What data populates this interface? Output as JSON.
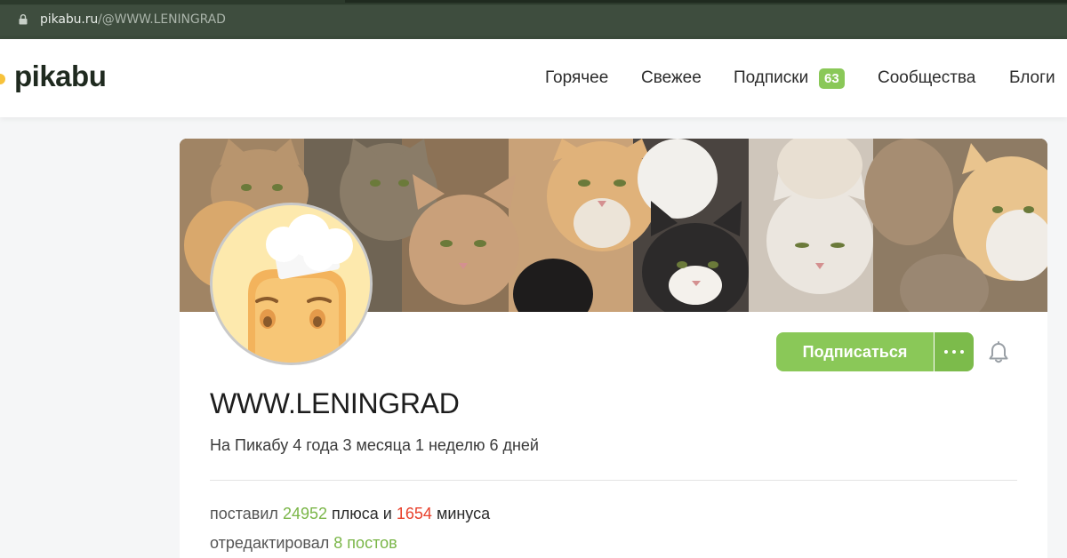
{
  "browser": {
    "url_host": "pikabu.ru",
    "url_path": "/@WWW.LENINGRAD"
  },
  "header": {
    "logo": "pikabu",
    "nav": {
      "hot": "Горячее",
      "fresh": "Свежее",
      "subscriptions": "Подписки",
      "subscriptions_count": "63",
      "communities": "Сообщества",
      "blogs": "Блоги"
    }
  },
  "profile": {
    "username": "WWW.LENINGRAD",
    "since": "На Пикабу 4 года 3 месяца 1 неделю 6 дней",
    "subscribe_label": "Подписаться",
    "stats": {
      "voted_prefix": "поставил",
      "pluses": "24952",
      "pluses_label": "плюса и",
      "minuses": "1654",
      "minuses_label": "минуса",
      "edited_prefix": "отредактировал",
      "edited_value": "8 постов"
    }
  },
  "colors": {
    "accent_green": "#8ac858",
    "minus_red": "#e8412c",
    "address_bar": "#3b4a3b"
  },
  "icons": {
    "lock": "lock-icon",
    "bell": "bell-icon",
    "more": "more-dots-icon"
  }
}
